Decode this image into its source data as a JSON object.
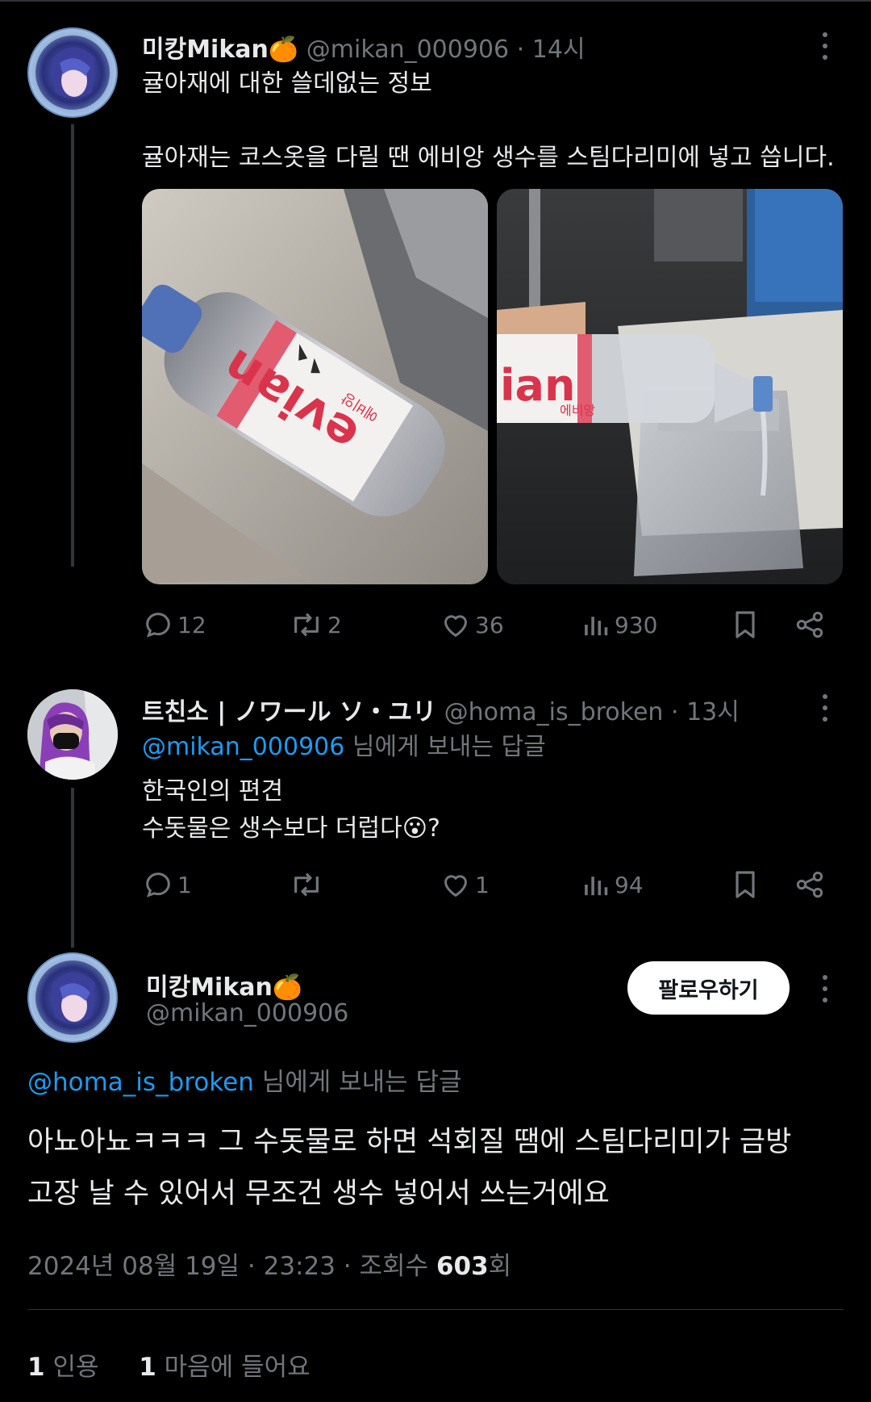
{
  "tweet1": {
    "name": "미캉Mikan",
    "name_emoji": "🍊",
    "handle": "@mikan_000906",
    "time_sep": "·",
    "time": "14시",
    "line1": "귤아재에 대한 쓸데없는 정보",
    "line2": "귤아재는 코스옷을 다릴 땐 에비앙 생수를 스팀다리미에 넣고 씁니다.",
    "photo1_label": "evian",
    "photo1_sub": "에비앙",
    "photo2_label": "ian",
    "photo2_sub": "에비앙",
    "replies": "12",
    "reposts": "2",
    "likes": "36",
    "views": "930"
  },
  "tweet2": {
    "name": "트친소 | ノワール ソ・ユリ",
    "handle": "@homa_is_broken",
    "time_sep": "·",
    "time": "13시",
    "reply_to_handle": "@mikan_000906",
    "reply_to_suffix": " 님에게 보내는 답글",
    "line1": "한국인의 편견",
    "line2": "수돗물은 생수보다 더럽다",
    "line2_emoji": "😮",
    "line2_end": "?",
    "replies": "1",
    "reposts": "",
    "likes": "1",
    "views": "94"
  },
  "main": {
    "name": "미캉Mikan",
    "name_emoji": "🍊",
    "handle": "@mikan_000906",
    "follow_label": "팔로우하기",
    "reply_to_handle": "@homa_is_broken",
    "reply_to_suffix": " 님에게 보내는 답글",
    "line1": "아뇨아뇨ㅋㅋㅋ 그 수돗물로 하면 석회질 땜에 스팀다리미가 금방",
    "line2": "고장 날 수 있어서 무조건 생수 넣어서 쓰는거에요",
    "date": "2024년 08월 19일 · 23:23 · 조회수 ",
    "views_count": "603",
    "views_suffix": "회",
    "quote_count": "1",
    "quote_label": "인용",
    "like_count": "1",
    "like_label": "마음에 들어요"
  },
  "icons": {
    "reply": "reply-icon",
    "repost": "repost-icon",
    "like": "heart-icon",
    "views": "views-icon",
    "bookmark": "bookmark-icon",
    "share": "share-icon",
    "more": "more-icon"
  },
  "colors": {
    "background": "#000000",
    "text": "#e7e9ea",
    "muted": "#71767b",
    "mention": "#1d9bf0",
    "follow_bg": "#ffffff"
  }
}
